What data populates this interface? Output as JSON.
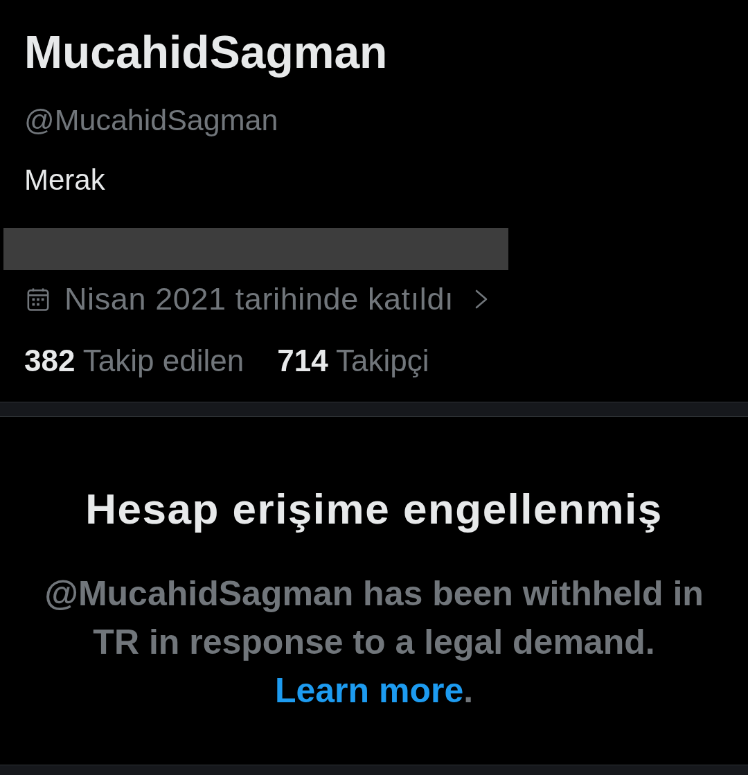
{
  "profile": {
    "display_name": "MucahidSagman",
    "handle": "@MucahidSagman",
    "bio": "Merak",
    "joined": "Nisan 2021 tarihinde katıldı",
    "stats": [
      {
        "count": "382",
        "label": "Takip edilen"
      },
      {
        "count": "714",
        "label": "Takipçi"
      }
    ]
  },
  "notice": {
    "title": "Hesap erişime engellenmiş",
    "message": "@MucahidSagman has been withheld in TR in response to a legal demand.",
    "link": "Learn more",
    "suffix": "."
  }
}
